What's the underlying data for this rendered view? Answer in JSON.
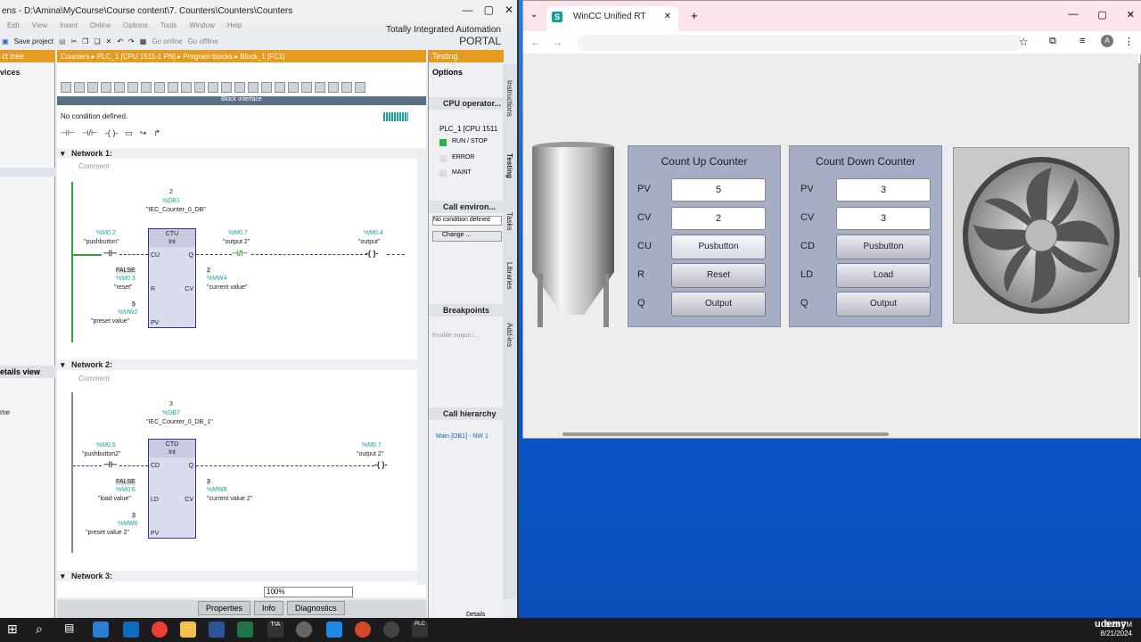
{
  "tia": {
    "title": "ens - D:\\Amina\\MyCourse\\Course content\\7. Counters\\Counters\\Counters",
    "menu": [
      "Edit",
      "View",
      "Insert",
      "Online",
      "Options",
      "Tools",
      "Window",
      "Help"
    ],
    "save_label": "Save project",
    "go_online": "Go online",
    "go_offline": "Go offline",
    "portal_line1": "Totally Integrated Automation",
    "portal_line2": "PORTAL",
    "project_tree": "ct tree",
    "devices": "vices",
    "details_view": "etails view",
    "name_col": "me",
    "breadcrumb": "Counters  ▸  PLC_1 [CPU 1511-1 PN]  ▸  Program blocks  ▸  Block_1 [FC1]",
    "block_interface": "Block interface",
    "no_condition": "No condition defined.",
    "zoom": "100%",
    "bottom_tabs": [
      "Properties",
      "Info",
      "Diagnostics"
    ],
    "network1": {
      "title": "Network 1:",
      "comment": "Comment",
      "db_num": "2",
      "db_tag": "%DB1",
      "db_name": "\"IEC_Counter_0_DB\"",
      "block_type": "CTU",
      "block_dtype": "Int",
      "in1_tag": "%M0.2",
      "in1_name": "\"pushbutton\"",
      "r_val": "FALSE",
      "r_tag": "%M0.3",
      "r_name": "\"reset\"",
      "pv_val": "5",
      "pv_tag": "%MW2",
      "pv_name": "\"preset value\"",
      "q_tag": "%M0.7",
      "q_name": "\"output 2\"",
      "cv_val": "2",
      "cv_tag": "%MW4",
      "cv_name": "\"current value\"",
      "out_tag": "%M0.4",
      "out_name": "\"output\"",
      "pins": [
        "CU",
        "R",
        "PV",
        "Q",
        "CV"
      ]
    },
    "network2": {
      "title": "Network 2:",
      "comment": "Comment",
      "db_num": "3",
      "db_tag": "%DB7",
      "db_name": "\"IEC_Counter_0_DB_1\"",
      "block_type": "CTD",
      "block_dtype": "Int",
      "in1_tag": "%M0.5",
      "in1_name": "\"pushbutton2\"",
      "ld_val": "FALSE",
      "ld_tag": "%M0.6",
      "ld_name": "\"load value\"",
      "pv_val": "3",
      "pv_tag": "%MW6",
      "pv_name": "\"preset value 2\"",
      "cv_val": "3",
      "cv_tag": "%MW8",
      "cv_name": "\"current value 2\"",
      "out_tag": "%M0.7",
      "out_name": "\"output 2\"",
      "pins": [
        "CD",
        "LD",
        "PV",
        "Q",
        "CV"
      ]
    },
    "network3": "Network 3:",
    "testing": {
      "title": "Testing",
      "options": "Options",
      "cpu_operator": "CPU operator...",
      "plc": "PLC_1 [CPU 1511",
      "run_stop": "RUN / STOP",
      "error": "ERROR",
      "maint": "MAINT",
      "call_env": "Call environ...",
      "no_cond": "No condition defined",
      "change": "Change ...",
      "breakpoints": "Breakpoints",
      "enable_output": "Enable output i...",
      "call_hierarchy": "Call hierarchy",
      "main_ob": "Main [OB1] - NW 1",
      "side_tabs": [
        "Instructions",
        "Testing",
        "Tasks",
        "Libraries",
        "Add-ins"
      ],
      "details": "Details"
    }
  },
  "browser": {
    "tab_title": "WinCC Unified RT",
    "count_up": {
      "title": "Count Up Counter",
      "pv_label": "PV",
      "pv": "5",
      "cv_label": "CV",
      "cv": "2",
      "cu_label": "CU",
      "cu_btn": "Pusbutton",
      "r_label": "R",
      "r_btn": "Reset",
      "q_label": "Q",
      "q_btn": "Output"
    },
    "count_down": {
      "title": "Count Down Counter",
      "pv_label": "PV",
      "pv": "3",
      "cv_label": "CV",
      "cv": "3",
      "cd_label": "CD",
      "cd_btn": "Pusbutton",
      "ld_label": "LD",
      "ld_btn": "Load",
      "q_label": "Q",
      "q_btn": "Output"
    }
  },
  "taskbar": {
    "time": "9:23 PM",
    "date": "8/21/2024",
    "udemy": "udemy"
  },
  "colors": {
    "accent": "#e39b20",
    "plc_green": "#35a33a",
    "tag_teal": "#1aa0a5",
    "panel": "#a8adc6"
  }
}
